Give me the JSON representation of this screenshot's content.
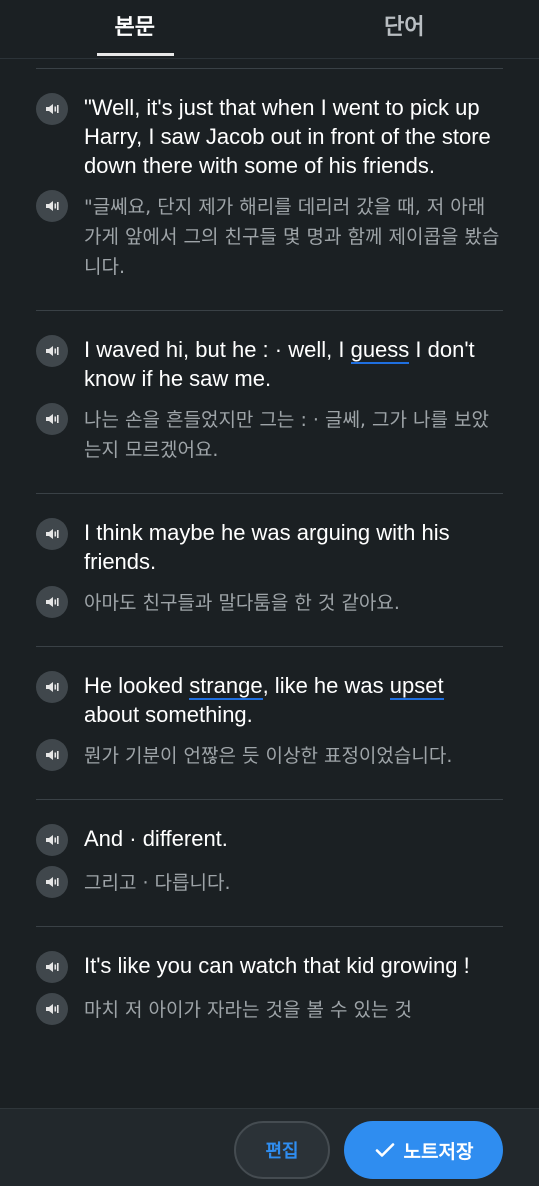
{
  "tabs": [
    {
      "label": "본문"
    },
    {
      "label": "단어"
    }
  ],
  "sentences": [
    {
      "en": "\"Well, it's just that when I went to pick up Harry, I saw Jacob out in front of the store down there with some of his friends.",
      "ko": "\"글쎄요, 단지 제가 해리를 데리러 갔을 때, 저 아래 가게 앞에서 그의 친구들 몇 명과 함께 제이콥을 봤습니다."
    },
    {
      "en_parts": [
        "I waved hi, but he : · well, I ",
        "guess",
        " I don't know if he saw me."
      ],
      "ko": "나는 손을 흔들었지만 그는 : · 글쎄, 그가 나를 보았는지 모르겠어요."
    },
    {
      "en": "I think maybe he was arguing with his friends.",
      "ko": "아마도 친구들과 말다툼을 한 것 같아요."
    },
    {
      "en_parts": [
        "He looked ",
        "strange",
        ", like he was ",
        "upset",
        " about something."
      ],
      "ko": "뭔가 기분이 언짢은 듯 이상한 표정이었습니다."
    },
    {
      "en": "And · different.",
      "ko": "그리고 · 다릅니다."
    },
    {
      "en": "It's like you can watch that kid growing !",
      "ko": "마치 저 아이가 자라는 것을 볼 수 있는 것"
    }
  ],
  "bottom": {
    "edit_label": "편집",
    "save_label": "노트저장"
  },
  "icons": {
    "speaker": "speaker-icon",
    "check": "check-icon"
  },
  "colors": {
    "background": "#1b2023",
    "accent": "#2f8df0",
    "highlight_underline": "#1f6fe0"
  }
}
